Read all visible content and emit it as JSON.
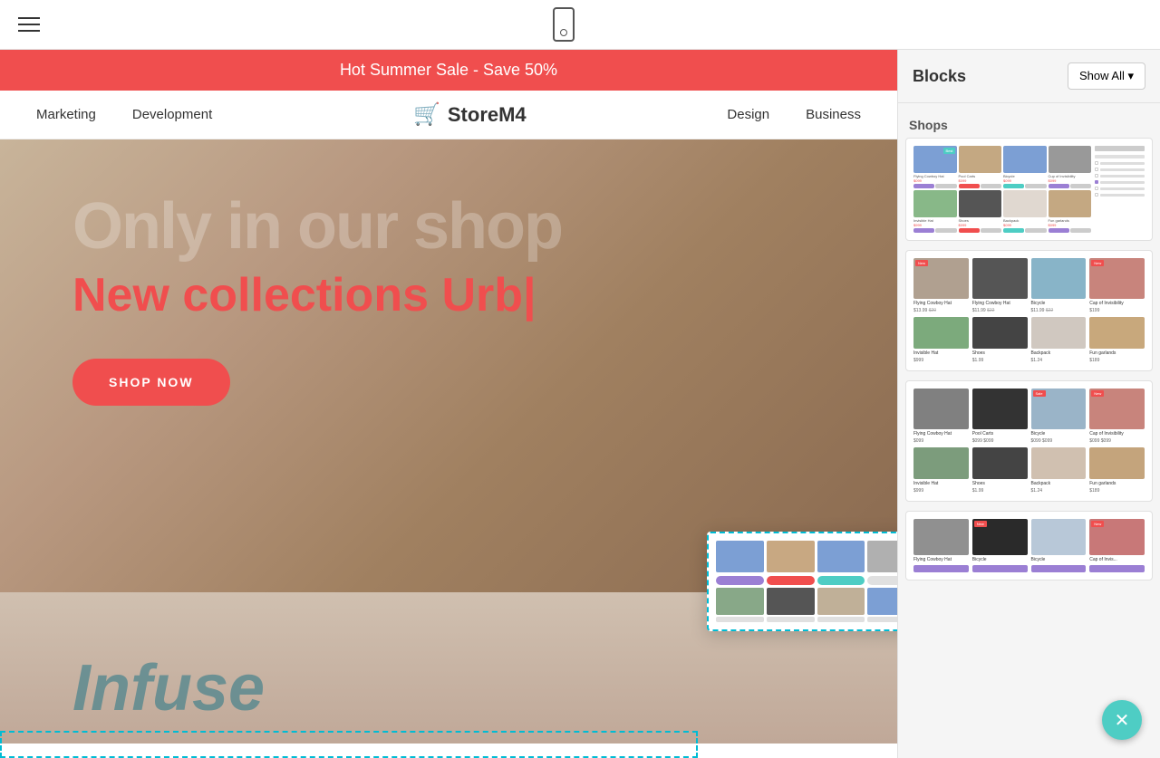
{
  "toolbar": {
    "title": "StoreM4",
    "show_all_label": "Show All ▾"
  },
  "announcement": {
    "text": "Hot Summer Sale - Save 50%"
  },
  "nav": {
    "links": [
      "Marketing",
      "Development",
      "Design",
      "Business"
    ],
    "logo_text": "StoreM4"
  },
  "hero": {
    "title_main": "Only in our shop",
    "subtitle": "New collections",
    "subtitle_accent": "Urb|",
    "cta_button": "SHOP NOW"
  },
  "bottom_section": {
    "text": "Infuse"
  },
  "panel": {
    "title": "Blocks",
    "show_all": "Show All ▾",
    "section_label": "Shops",
    "close_icon": "✕"
  }
}
